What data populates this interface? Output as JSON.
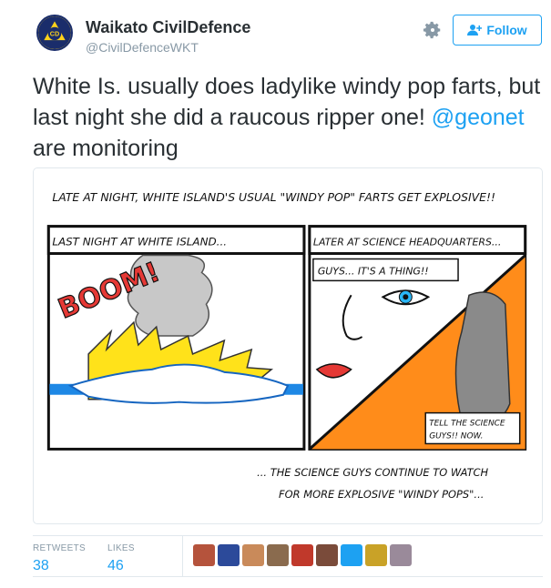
{
  "account": {
    "name": "Waikato CivilDefence",
    "handle": "@CivilDefenceWKT",
    "avatar_initials": "CD",
    "avatar_ring_text": "CIVIL DEFENCE"
  },
  "actions": {
    "follow_label": "Follow"
  },
  "tweet": {
    "text_part1": "White Is. usually does ladylike windy pop farts, but last night she did a raucous ripper one!",
    "mention": "@geonet",
    "text_part2": " are monitoring"
  },
  "comic": {
    "top_caption": "LATE AT NIGHT, WHITE ISLAND'S USUAL \"WINDY POP\" FARTS GET EXPLOSIVE!!",
    "panel1_caption": "LAST NIGHT AT WHITE ISLAND...",
    "boom": "BOOM!",
    "panel2_caption": "LATER AT SCIENCE HEADQUARTERS...",
    "speech_bubble": "GUYS... IT'S A THING!!",
    "phone_bubble_line1": "TELL THE SCIENCE",
    "phone_bubble_line2": "GUYS!! NOW.",
    "bottom_caption_line1": "... THE SCIENCE GUYS CONTINUE TO WATCH",
    "bottom_caption_line2": "FOR MORE EXPLOSIVE \"WINDY POPS\"..."
  },
  "stats": {
    "retweets_label": "RETWEETS",
    "retweets_value": "38",
    "likes_label": "LIKES",
    "likes_value": "46"
  },
  "likers": [
    {
      "icon": "liker-avatar",
      "color": "#b5533c"
    },
    {
      "icon": "liker-avatar",
      "color": "#2c4a9a"
    },
    {
      "icon": "liker-avatar",
      "color": "#c98a5a"
    },
    {
      "icon": "liker-avatar",
      "color": "#8a6b4e"
    },
    {
      "icon": "liker-avatar",
      "color": "#c0392b"
    },
    {
      "icon": "liker-avatar",
      "color": "#7a4b3a"
    },
    {
      "icon": "liker-avatar",
      "color": "#1da1f2"
    },
    {
      "icon": "liker-avatar",
      "color": "#c9a227"
    },
    {
      "icon": "liker-avatar",
      "color": "#9a8a9a"
    }
  ],
  "colors": {
    "accent": "#1da1f2",
    "text": "#292f33",
    "muted": "#8899a6",
    "border": "#e1e8ed"
  }
}
